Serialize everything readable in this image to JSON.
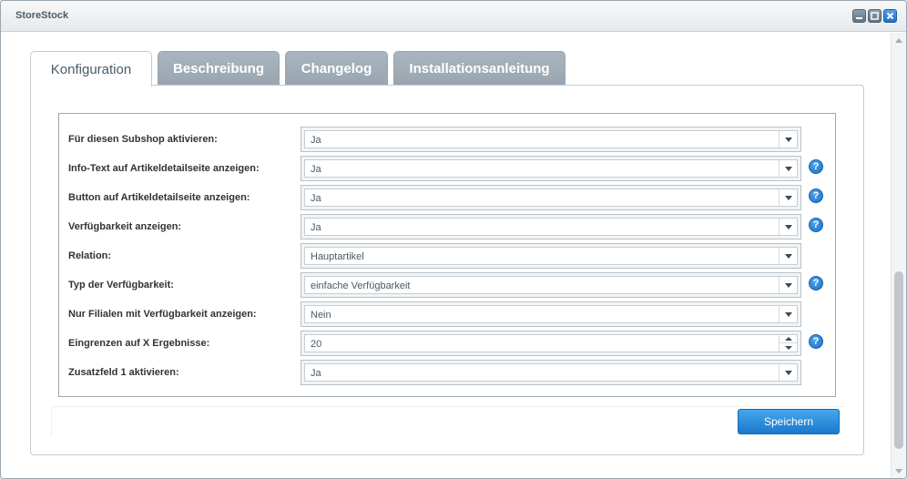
{
  "window": {
    "title": "StoreStock",
    "buttons": [
      {
        "name": "minimize-icon"
      },
      {
        "name": "maximize-icon"
      },
      {
        "name": "close-icon"
      }
    ]
  },
  "tabs": [
    {
      "label": "Konfiguration",
      "active": true
    },
    {
      "label": "Beschreibung",
      "active": false
    },
    {
      "label": "Changelog",
      "active": false
    },
    {
      "label": "Installationsanleitung",
      "active": false
    }
  ],
  "form": {
    "rows": [
      {
        "label": "Für diesen Subshop aktivieren:",
        "value": "Ja",
        "type": "select",
        "help": false
      },
      {
        "label": "Info-Text auf Artikeldetailseite anzeigen:",
        "value": "Ja",
        "type": "select",
        "help": true
      },
      {
        "label": "Button auf Artikeldetailseite anzeigen:",
        "value": "Ja",
        "type": "select",
        "help": true
      },
      {
        "label": "Verfügbarkeit anzeigen:",
        "value": "Ja",
        "type": "select",
        "help": true
      },
      {
        "label": "Relation:",
        "value": "Hauptartikel",
        "type": "select",
        "help": false
      },
      {
        "label": "Typ der Verfügbarkeit:",
        "value": "einfache Verfügbarkeit",
        "type": "select",
        "help": true
      },
      {
        "label": "Nur Filialen mit Verfügbarkeit anzeigen:",
        "value": "Nein",
        "type": "select",
        "help": false
      },
      {
        "label": "Eingrenzen auf X Ergebnisse:",
        "value": "20",
        "type": "number",
        "help": true
      },
      {
        "label": "Zusatzfeld 1 aktivieren:",
        "value": "Ja",
        "type": "select",
        "help": false
      }
    ],
    "help_glyph": "?"
  },
  "footer": {
    "save_label": "Speichern"
  },
  "colors": {
    "accent": "#1a79cc",
    "tab_inactive": "#98a5b0"
  }
}
